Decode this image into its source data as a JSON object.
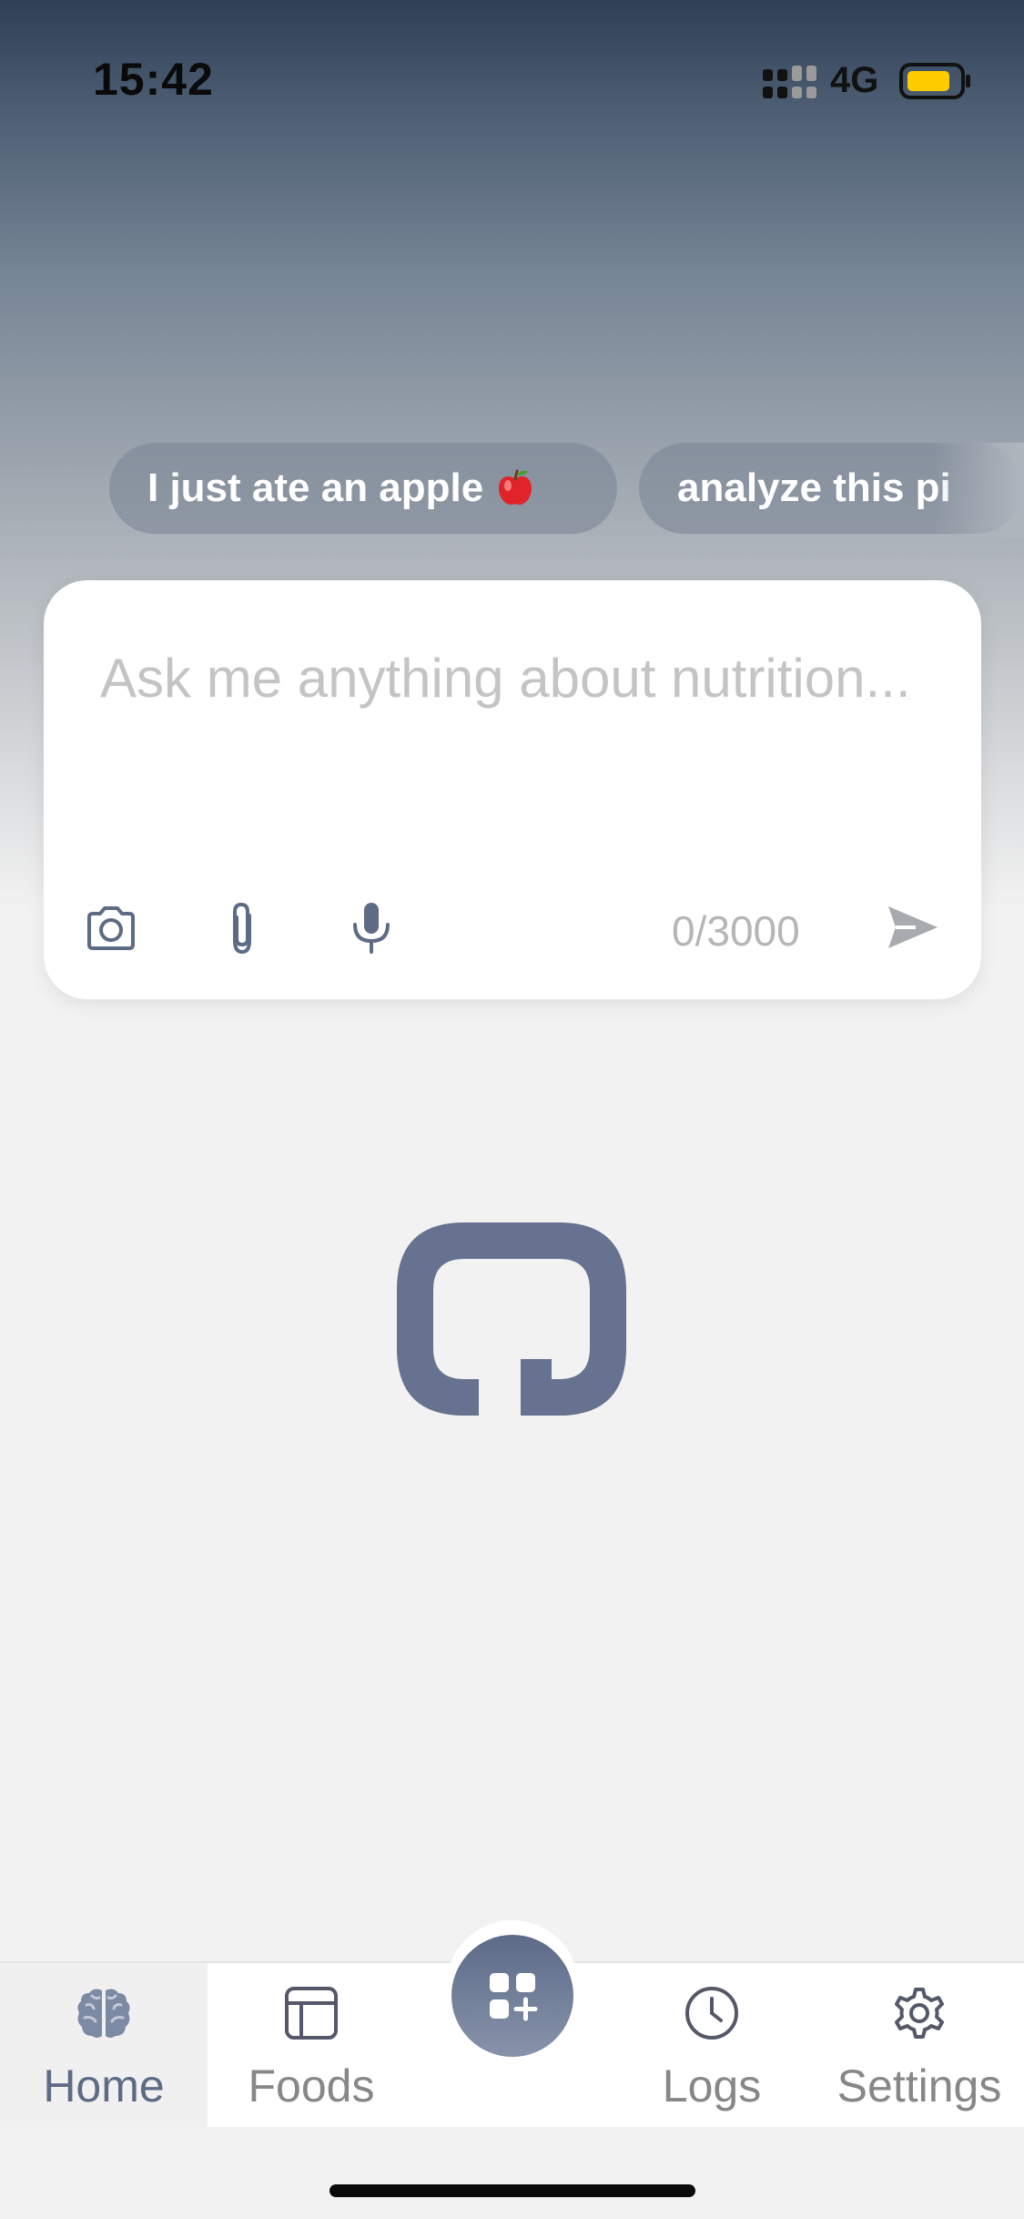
{
  "status_bar": {
    "time": "15:42",
    "network": "4G",
    "icons": [
      "signal-icon",
      "battery-icon"
    ]
  },
  "suggestions": [
    {
      "label": "I just ate an apple",
      "icon": "apple-icon"
    },
    {
      "label": "analyze this pi"
    }
  ],
  "input": {
    "placeholder": "Ask me anything about nutrition...",
    "counter": "0/3000",
    "tools": [
      "camera-icon",
      "attach-icon",
      "mic-icon",
      "send-icon"
    ]
  },
  "logo": {
    "icon": "app-logo"
  },
  "tabs": [
    {
      "label": "Home",
      "icon": "brain-icon",
      "active": true
    },
    {
      "label": "Foods",
      "icon": "table-icon",
      "active": false
    },
    {
      "label": "",
      "icon": "add-grid-icon",
      "active": false
    },
    {
      "label": "Logs",
      "icon": "clock-icon",
      "active": false
    },
    {
      "label": "Settings",
      "icon": "gear-icon",
      "active": false
    }
  ],
  "colors": {
    "accent": "#5d6b85",
    "logo": "#66728f",
    "placeholder": "#c4c4c4",
    "inactive_tab": "#878787",
    "battery": "#ffcc00"
  }
}
